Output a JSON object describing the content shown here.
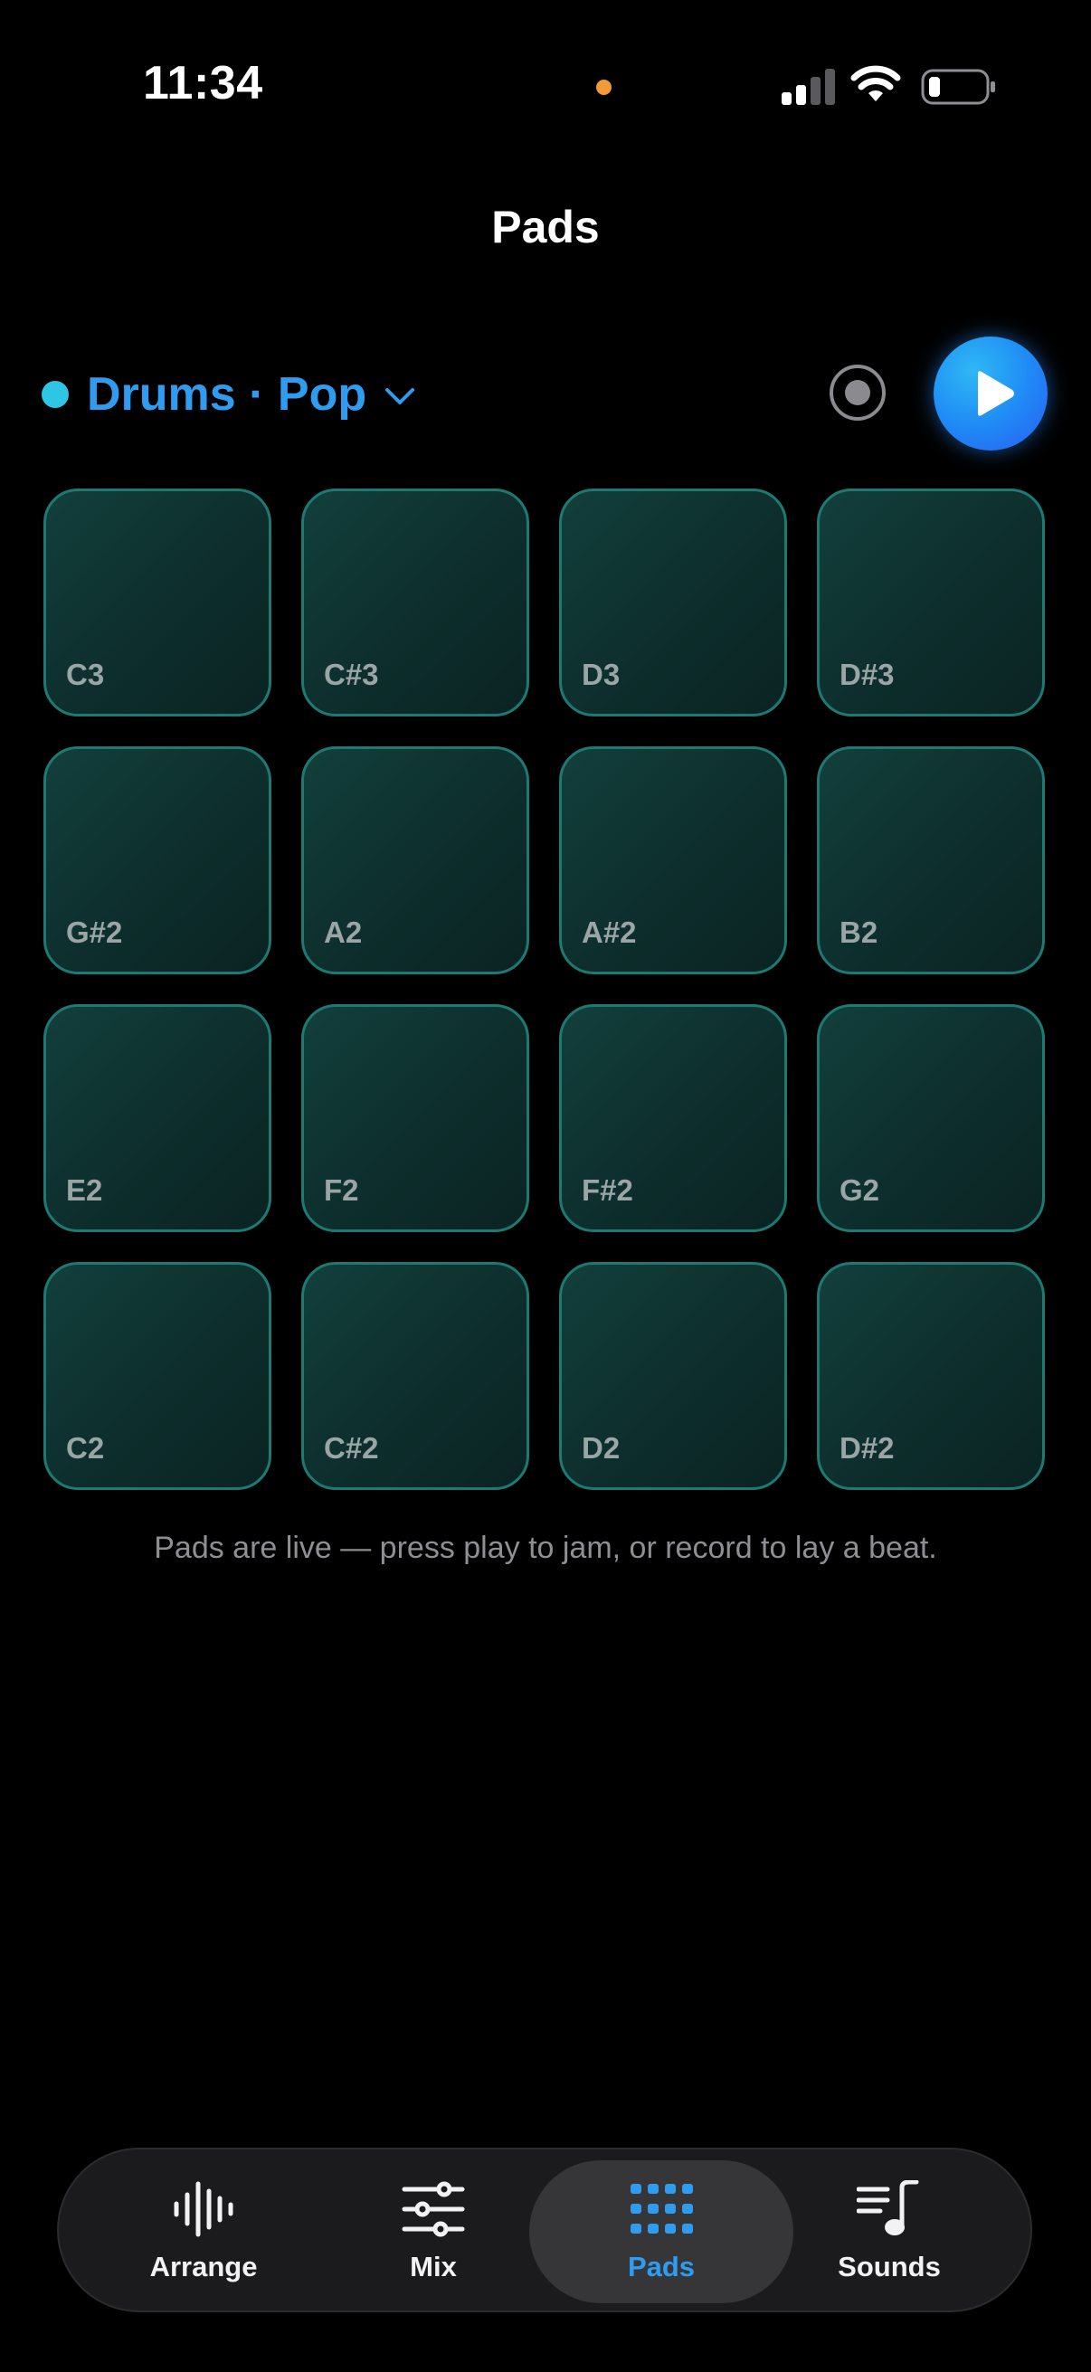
{
  "status_bar": {
    "time": "11:34",
    "recording_indicator_color": "#f29a3a"
  },
  "header": {
    "title": "Pads"
  },
  "kit": {
    "label": "Drums · Pop",
    "dot_color": "#2ec6e4",
    "label_color": "#2f9cf0"
  },
  "transport": {
    "record_icon": "record-icon",
    "play_icon": "play-icon"
  },
  "pads": [
    {
      "note": "C3"
    },
    {
      "note": "C#3"
    },
    {
      "note": "D3"
    },
    {
      "note": "D#3"
    },
    {
      "note": "G#2"
    },
    {
      "note": "A2"
    },
    {
      "note": "A#2"
    },
    {
      "note": "B2"
    },
    {
      "note": "E2"
    },
    {
      "note": "F2"
    },
    {
      "note": "F#2"
    },
    {
      "note": "G2"
    },
    {
      "note": "C2"
    },
    {
      "note": "C#2"
    },
    {
      "note": "D2"
    },
    {
      "note": "D#2"
    }
  ],
  "hint": "Pads are live — press play to jam, or record to lay a beat.",
  "tab_bar": {
    "active": "Pads",
    "tabs": [
      {
        "label": "Arrange",
        "icon": "waveform-icon"
      },
      {
        "label": "Mix",
        "icon": "sliders-icon"
      },
      {
        "label": "Pads",
        "icon": "grid-dots-icon"
      },
      {
        "label": "Sounds",
        "icon": "music-note-list-icon"
      }
    ]
  },
  "colors": {
    "accent": "#2f9cf0",
    "pad_fill": "#123f3c",
    "pad_border": "#1c7a73",
    "background": "#000000"
  }
}
